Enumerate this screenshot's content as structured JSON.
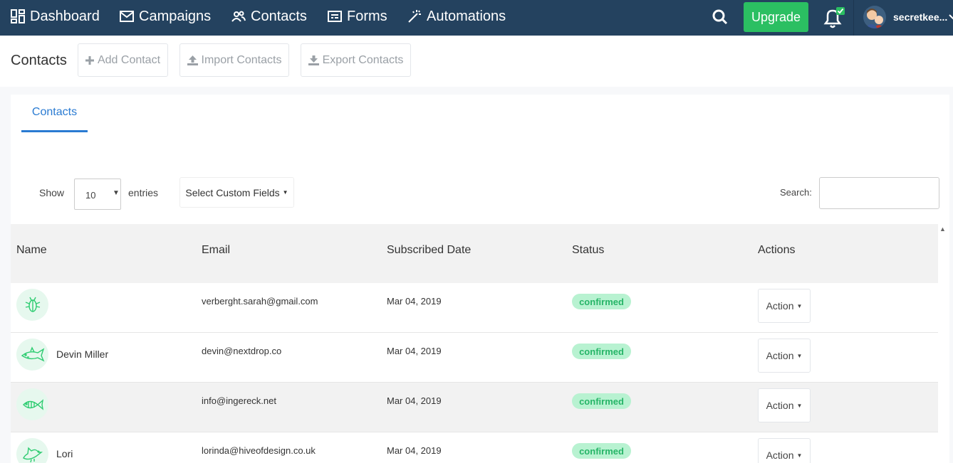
{
  "nav": {
    "items": [
      {
        "label": "Dashboard",
        "icon": "dashboard-grid-icon"
      },
      {
        "label": "Campaigns",
        "icon": "envelope-icon"
      },
      {
        "label": "Contacts",
        "icon": "people-icon"
      },
      {
        "label": "Forms",
        "icon": "form-icon"
      },
      {
        "label": "Automations",
        "icon": "magic-wand-icon"
      }
    ],
    "upgrade_label": "Upgrade",
    "username": "secretkee...",
    "colors": {
      "nav_bg": "#24425f",
      "upgrade": "#2bbf62",
      "notification_badge": "#2bbf62"
    }
  },
  "header": {
    "title": "Contacts",
    "buttons": [
      "Add Contact",
      "Import Contacts",
      "Export Contacts"
    ]
  },
  "tabs": [
    "Contacts"
  ],
  "table_controls": {
    "show_label": "Show",
    "entries_value": "10",
    "entries_label": "entries",
    "custom_fields_label": "Select Custom Fields",
    "search_label": "Search:",
    "search_value": ""
  },
  "table": {
    "columns": [
      "Name",
      "Email",
      "Subscribed Date",
      "Status",
      "Actions"
    ],
    "rows": [
      {
        "name": "",
        "email": "verberght.sarah@gmail.com",
        "date": "Mar 04, 2019",
        "status": "confirmed",
        "action": "Action",
        "avatar": "bug-icon"
      },
      {
        "name": "Devin Miller",
        "email": "devin@nextdrop.co",
        "date": "Mar 04, 2019",
        "status": "confirmed",
        "action": "Action",
        "avatar": "shark-icon"
      },
      {
        "name": "",
        "email": "info@ingereck.net",
        "date": "Mar 04, 2019",
        "status": "confirmed",
        "action": "Action",
        "avatar": "fish-icon"
      },
      {
        "name": "Lori",
        "email": "lorinda@hiveofdesign.co.uk",
        "date": "Mar 04, 2019",
        "status": "confirmed",
        "action": "Action",
        "avatar": "bird-icon"
      }
    ],
    "status_colors": {
      "confirmed_bg": "#b8f2d1",
      "confirmed_text": "#27b568"
    }
  }
}
